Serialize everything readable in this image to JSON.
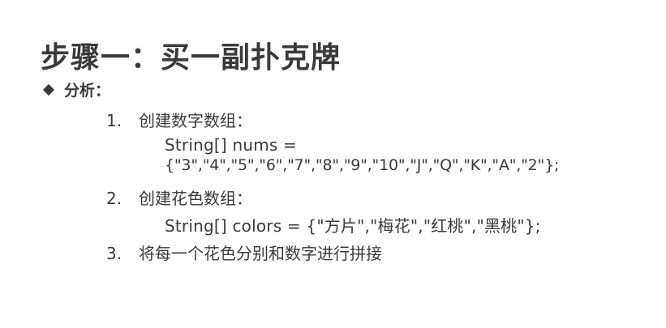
{
  "title": "步骤一：买一副扑克牌",
  "bullet": {
    "label": "分析："
  },
  "steps": [
    {
      "number": "1.",
      "text": "创建数字数组：",
      "code": [
        "String[] nums  =",
        "{\"3\",\"4\",\"5\",\"6\",\"7\",\"8\",\"9\",\"10\",\"J\",\"Q\",\"K\",\"A\",\"2\"};"
      ]
    },
    {
      "number": "2.",
      "text": "创建花色数组：",
      "code": [
        "String[] colors = {\"方片\",\"梅花\",\"红桃\",\"黑桃\"};"
      ]
    },
    {
      "number": "3.",
      "text": "将每一个花色分别和数字进行拼接",
      "code": []
    }
  ]
}
